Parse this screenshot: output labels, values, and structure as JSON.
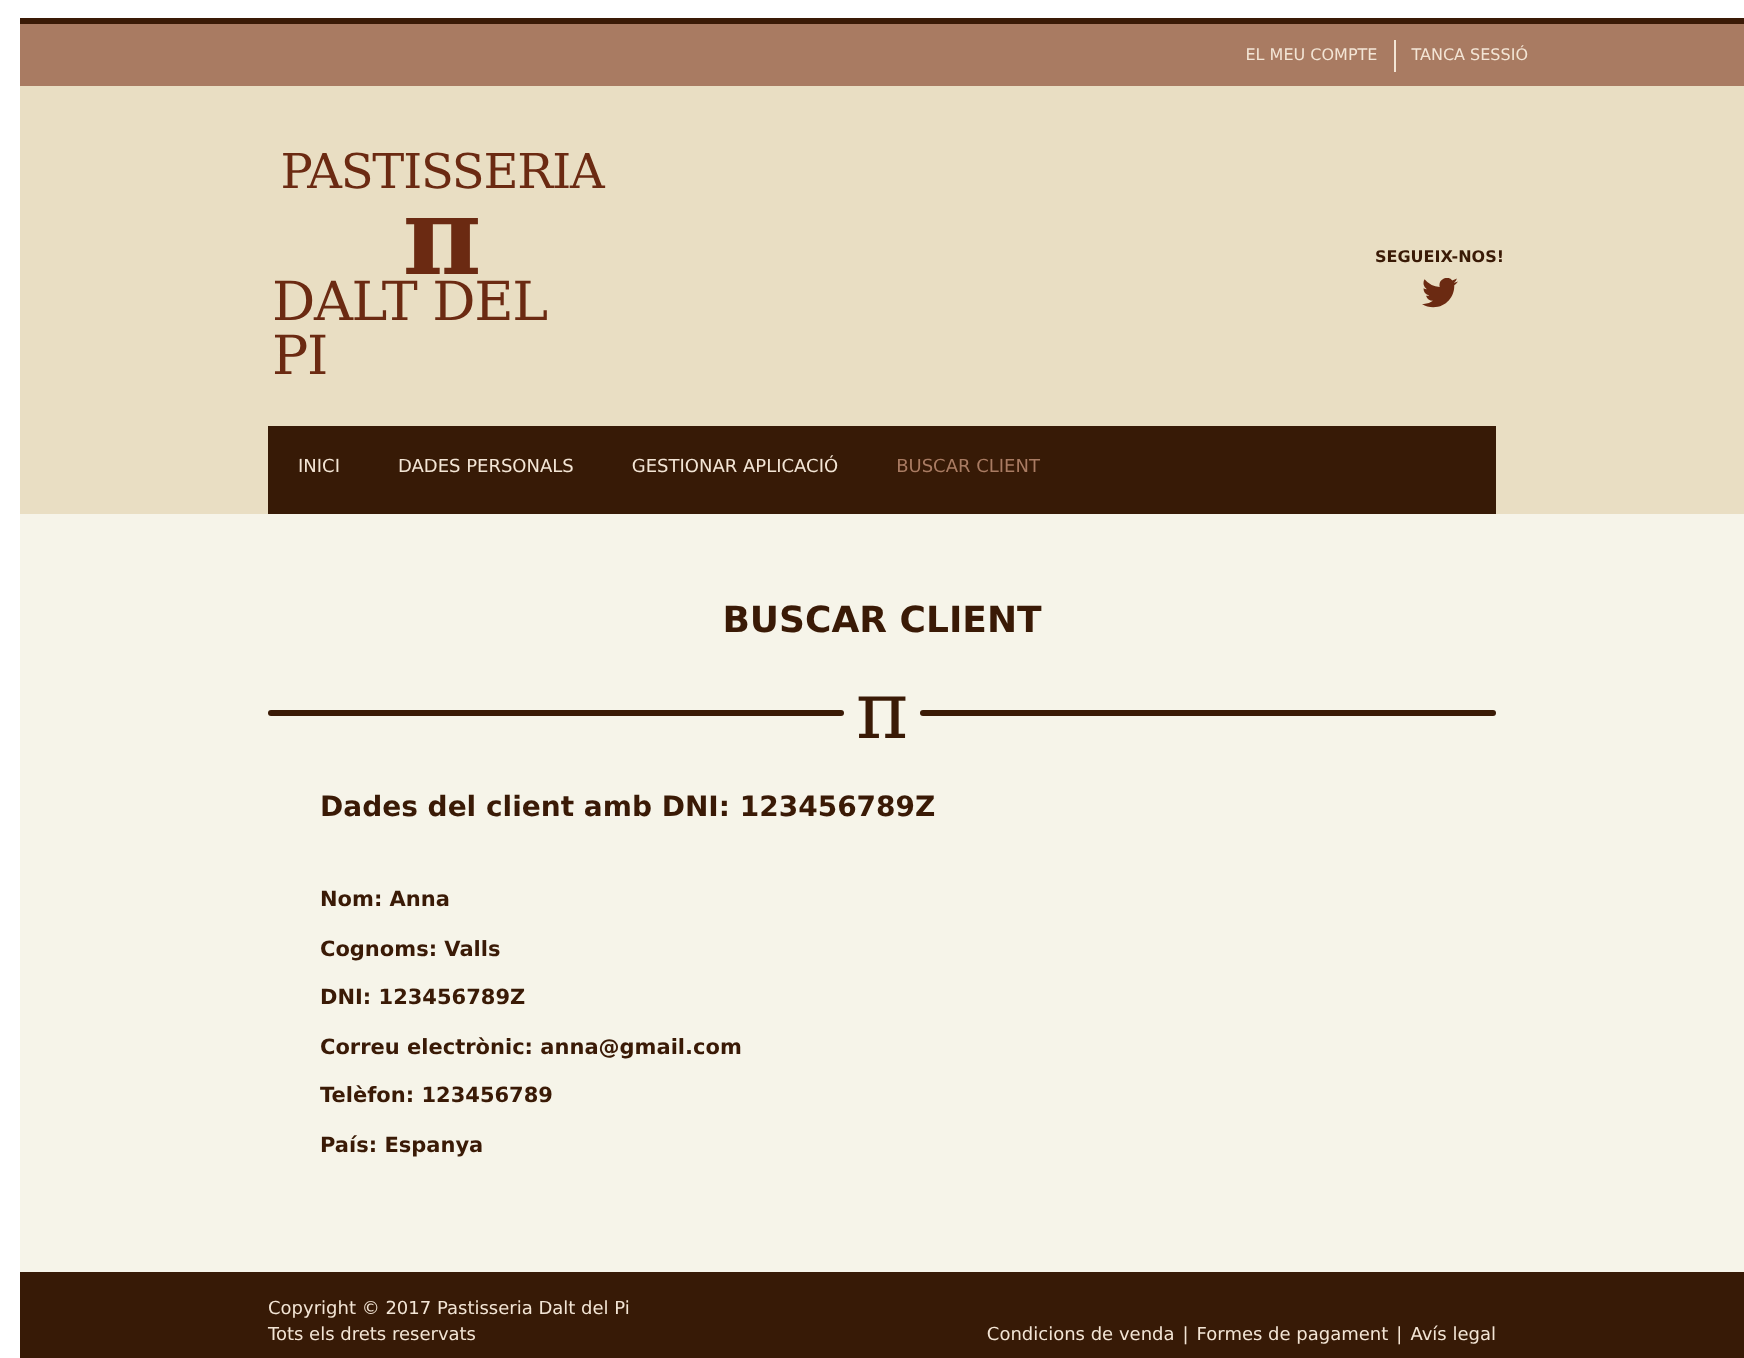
{
  "top_bar": {
    "links": [
      "EL MEU COMPTE",
      "TANCA SESSIÓ"
    ]
  },
  "logo": {
    "line_1": "PASTISSERIA",
    "symbol": "π",
    "line_2": "DALT DEL PI"
  },
  "social": {
    "label": "SEGUEIX-NOS!"
  },
  "nav": [
    {
      "label": "INICI",
      "selected": false
    },
    {
      "label": "DADES PERSONALS",
      "selected": false
    },
    {
      "label": "GESTIONAR APLICACIÓ",
      "selected": false
    },
    {
      "label": "BUSCAR CLIENT",
      "selected": true
    }
  ],
  "main": {
    "title": "BUSCAR CLIENT",
    "divider_symbol": "π",
    "subtitle": "Dades del client amb DNI: 123456789Z",
    "fields": [
      {
        "label": "Nom:",
        "value": "Anna"
      },
      {
        "label": "Cognoms:",
        "value": "Valls"
      },
      {
        "label": "DNI:",
        "value": "123456789Z"
      },
      {
        "label": "Correu electrònic:",
        "value": "anna@gmail.com"
      },
      {
        "label": "Telèfon:",
        "value": "123456789"
      },
      {
        "label": "País:",
        "value": "Espanya"
      }
    ]
  },
  "footer": {
    "copyright": "Copyright © 2017 Pastisseria Dalt del Pi",
    "rights": "Tots els drets reservats",
    "links": [
      "Condicions de venda",
      "Formes de pagament",
      "Avís legal"
    ],
    "separators": [
      "|",
      "|"
    ]
  }
}
